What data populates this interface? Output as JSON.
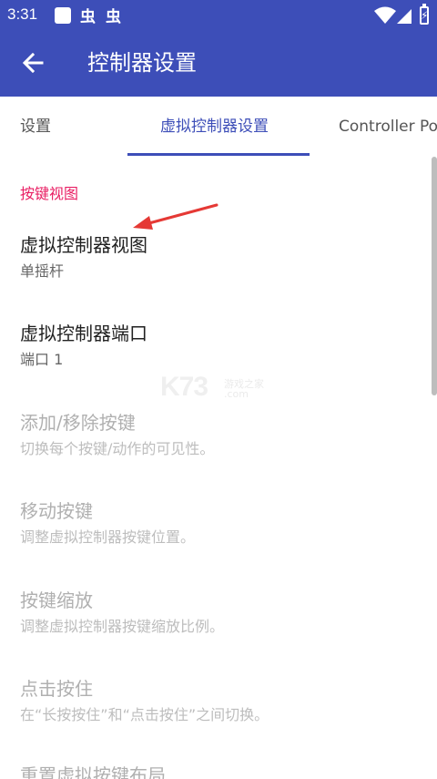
{
  "status_bar": {
    "time": "3:31",
    "app_icons": [
      "虫",
      "虫"
    ]
  },
  "app_bar": {
    "title": "控制器设置"
  },
  "tabs": [
    {
      "label": "设置",
      "active": false
    },
    {
      "label": "虚拟控制器设置",
      "active": true
    },
    {
      "label": "Controller Po",
      "active": false
    }
  ],
  "section": {
    "header": "按键视图"
  },
  "preferences": [
    {
      "title": "虚拟控制器视图",
      "summary": "单摇杆",
      "enabled": true
    },
    {
      "title": "虚拟控制器端口",
      "summary": "端口 1",
      "enabled": true
    },
    {
      "title": "添加/移除按键",
      "summary": "切换每个按键/动作的可见性。",
      "enabled": false
    },
    {
      "title": "移动按键",
      "summary": "调整虚拟控制器按键位置。",
      "enabled": false
    },
    {
      "title": "按键缩放",
      "summary": "调整虚拟控制器按键缩放比例。",
      "enabled": false
    },
    {
      "title": "点击按住",
      "summary": "在“长按按住”和“点击按住”之间切换。",
      "enabled": false
    },
    {
      "title": "重置虚拟按键布局",
      "summary": "",
      "enabled": false
    }
  ],
  "watermark": {
    "brand": "K73",
    "cn": "游戏之家",
    "domain": ".com"
  },
  "colors": {
    "primary": "#3d4eb8",
    "accent": "#e91e63",
    "annotation": "#e53935"
  }
}
